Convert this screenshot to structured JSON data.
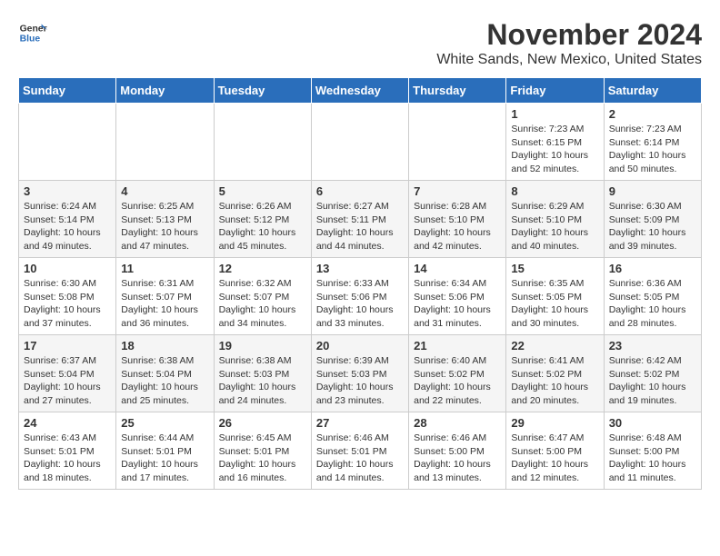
{
  "header": {
    "logo_line1": "General",
    "logo_line2": "Blue",
    "month": "November 2024",
    "location": "White Sands, New Mexico, United States"
  },
  "weekdays": [
    "Sunday",
    "Monday",
    "Tuesday",
    "Wednesday",
    "Thursday",
    "Friday",
    "Saturday"
  ],
  "weeks": [
    [
      {
        "day": "",
        "info": ""
      },
      {
        "day": "",
        "info": ""
      },
      {
        "day": "",
        "info": ""
      },
      {
        "day": "",
        "info": ""
      },
      {
        "day": "",
        "info": ""
      },
      {
        "day": "1",
        "info": "Sunrise: 7:23 AM\nSunset: 6:15 PM\nDaylight: 10 hours\nand 52 minutes."
      },
      {
        "day": "2",
        "info": "Sunrise: 7:23 AM\nSunset: 6:14 PM\nDaylight: 10 hours\nand 50 minutes."
      }
    ],
    [
      {
        "day": "3",
        "info": "Sunrise: 6:24 AM\nSunset: 5:14 PM\nDaylight: 10 hours\nand 49 minutes."
      },
      {
        "day": "4",
        "info": "Sunrise: 6:25 AM\nSunset: 5:13 PM\nDaylight: 10 hours\nand 47 minutes."
      },
      {
        "day": "5",
        "info": "Sunrise: 6:26 AM\nSunset: 5:12 PM\nDaylight: 10 hours\nand 45 minutes."
      },
      {
        "day": "6",
        "info": "Sunrise: 6:27 AM\nSunset: 5:11 PM\nDaylight: 10 hours\nand 44 minutes."
      },
      {
        "day": "7",
        "info": "Sunrise: 6:28 AM\nSunset: 5:10 PM\nDaylight: 10 hours\nand 42 minutes."
      },
      {
        "day": "8",
        "info": "Sunrise: 6:29 AM\nSunset: 5:10 PM\nDaylight: 10 hours\nand 40 minutes."
      },
      {
        "day": "9",
        "info": "Sunrise: 6:30 AM\nSunset: 5:09 PM\nDaylight: 10 hours\nand 39 minutes."
      }
    ],
    [
      {
        "day": "10",
        "info": "Sunrise: 6:30 AM\nSunset: 5:08 PM\nDaylight: 10 hours\nand 37 minutes."
      },
      {
        "day": "11",
        "info": "Sunrise: 6:31 AM\nSunset: 5:07 PM\nDaylight: 10 hours\nand 36 minutes."
      },
      {
        "day": "12",
        "info": "Sunrise: 6:32 AM\nSunset: 5:07 PM\nDaylight: 10 hours\nand 34 minutes."
      },
      {
        "day": "13",
        "info": "Sunrise: 6:33 AM\nSunset: 5:06 PM\nDaylight: 10 hours\nand 33 minutes."
      },
      {
        "day": "14",
        "info": "Sunrise: 6:34 AM\nSunset: 5:06 PM\nDaylight: 10 hours\nand 31 minutes."
      },
      {
        "day": "15",
        "info": "Sunrise: 6:35 AM\nSunset: 5:05 PM\nDaylight: 10 hours\nand 30 minutes."
      },
      {
        "day": "16",
        "info": "Sunrise: 6:36 AM\nSunset: 5:05 PM\nDaylight: 10 hours\nand 28 minutes."
      }
    ],
    [
      {
        "day": "17",
        "info": "Sunrise: 6:37 AM\nSunset: 5:04 PM\nDaylight: 10 hours\nand 27 minutes."
      },
      {
        "day": "18",
        "info": "Sunrise: 6:38 AM\nSunset: 5:04 PM\nDaylight: 10 hours\nand 25 minutes."
      },
      {
        "day": "19",
        "info": "Sunrise: 6:38 AM\nSunset: 5:03 PM\nDaylight: 10 hours\nand 24 minutes."
      },
      {
        "day": "20",
        "info": "Sunrise: 6:39 AM\nSunset: 5:03 PM\nDaylight: 10 hours\nand 23 minutes."
      },
      {
        "day": "21",
        "info": "Sunrise: 6:40 AM\nSunset: 5:02 PM\nDaylight: 10 hours\nand 22 minutes."
      },
      {
        "day": "22",
        "info": "Sunrise: 6:41 AM\nSunset: 5:02 PM\nDaylight: 10 hours\nand 20 minutes."
      },
      {
        "day": "23",
        "info": "Sunrise: 6:42 AM\nSunset: 5:02 PM\nDaylight: 10 hours\nand 19 minutes."
      }
    ],
    [
      {
        "day": "24",
        "info": "Sunrise: 6:43 AM\nSunset: 5:01 PM\nDaylight: 10 hours\nand 18 minutes."
      },
      {
        "day": "25",
        "info": "Sunrise: 6:44 AM\nSunset: 5:01 PM\nDaylight: 10 hours\nand 17 minutes."
      },
      {
        "day": "26",
        "info": "Sunrise: 6:45 AM\nSunset: 5:01 PM\nDaylight: 10 hours\nand 16 minutes."
      },
      {
        "day": "27",
        "info": "Sunrise: 6:46 AM\nSunset: 5:01 PM\nDaylight: 10 hours\nand 14 minutes."
      },
      {
        "day": "28",
        "info": "Sunrise: 6:46 AM\nSunset: 5:00 PM\nDaylight: 10 hours\nand 13 minutes."
      },
      {
        "day": "29",
        "info": "Sunrise: 6:47 AM\nSunset: 5:00 PM\nDaylight: 10 hours\nand 12 minutes."
      },
      {
        "day": "30",
        "info": "Sunrise: 6:48 AM\nSunset: 5:00 PM\nDaylight: 10 hours\nand 11 minutes."
      }
    ]
  ]
}
